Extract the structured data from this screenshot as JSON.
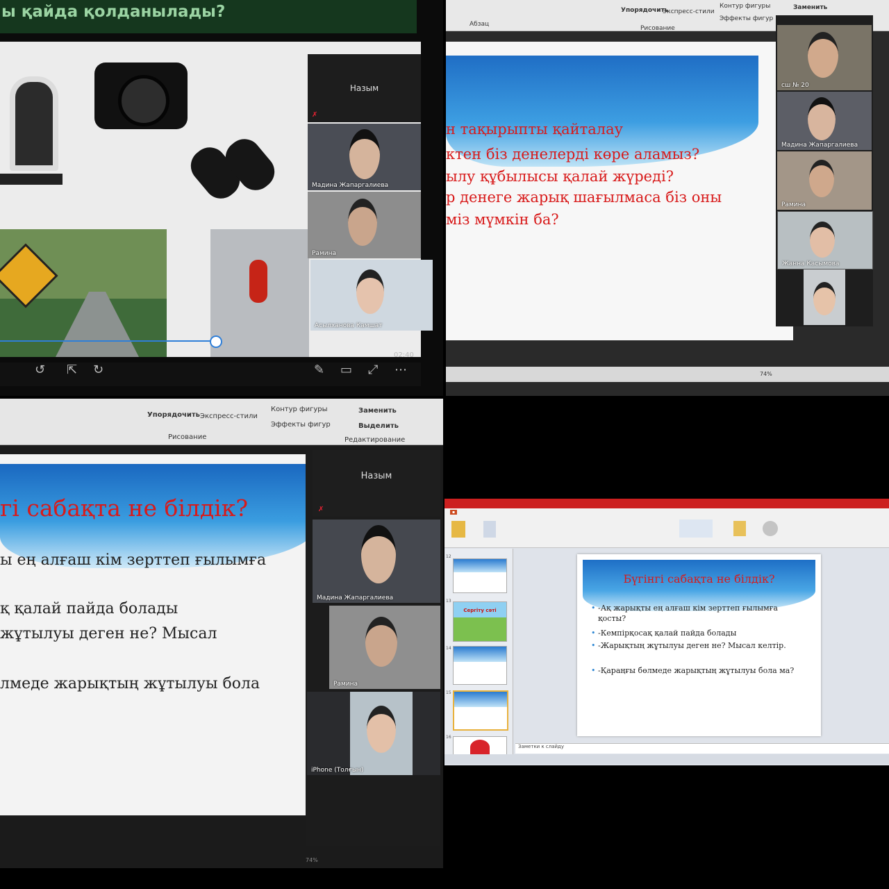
{
  "panel1": {
    "header_text": "ы қайда қолданылады?",
    "host_name": "Назым",
    "participants": [
      "Мадина Жапаргалиева",
      "Рамина",
      "Асылханова Камшат"
    ],
    "video_time": "02:40"
  },
  "panel2": {
    "ribbon": {
      "group_paragraph": "Абзац",
      "group_drawing": "Рисование",
      "arrange": "Упорядочить",
      "quick_styles": "Экспресс-стили",
      "shape_outline": "Контур фигуры",
      "shape_effects": "Эффекты фигур",
      "replace": "Заменить"
    },
    "slide_lines": [
      "н тақырыпты қайталау",
      "ктен біз денелерді көре аламыз?",
      "ылу құбылысы қалай жүреді?",
      "р денеге жарық шағылмаса біз оны",
      "міз мүмкін ба?"
    ],
    "participants": [
      "сш № 20",
      "Мадина Жапаргалиева",
      "Рамина",
      "Жанна Касымова"
    ],
    "zoom": "74%"
  },
  "panel3": {
    "ribbon": {
      "arrange": "Упорядочить",
      "quick_styles": "Экспресс-стили",
      "shape_outline": "Контур фигуры",
      "shape_effects": "Эффекты фигур",
      "replace": "Заменить",
      "select": "Выделить",
      "group_drawing": "Рисование",
      "group_editing": "Редактирование"
    },
    "slide_title": "гі сабақта не білдік?",
    "slide_lines": [
      "ы ең алғаш кім зерттеп ғылымға",
      "қ қалай пайда болады",
      "жұтылуы деген не? Мысал",
      "лмеде жарықтың жұтылуы бола"
    ],
    "host_name": "Назым",
    "participants": [
      "Мадина Жапаргалиева",
      "Рамина",
      "iPhone (Толғын)"
    ],
    "zoom": "74%"
  },
  "panel4": {
    "slide_title": "Бүгінгі сабақта не білдік?",
    "bullets": [
      "-Ақ жарықты ең алғаш кім зерттеп ғылымға қосты?",
      "-Кемпірқосақ қалай пайда болады",
      "-Жарықтың жұтылуы деген не? Мысал келтір.",
      "-Қараңғы бөлмеде жарықтың жұтылуы бола ма?"
    ],
    "thumb_labels": [
      "12",
      "13",
      "14",
      "15",
      "16"
    ],
    "thumb_text": "Сергіту сәті",
    "notes_placeholder": "Заметки к слайду"
  }
}
